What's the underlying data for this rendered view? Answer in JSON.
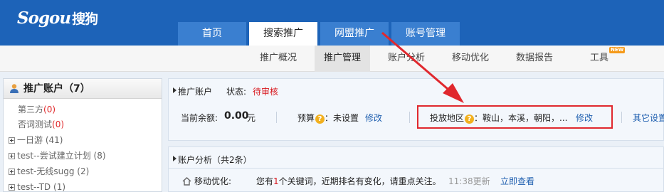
{
  "logo": {
    "text": "Sogou",
    "cn": "搜狗"
  },
  "main_tabs": [
    {
      "label": "首页"
    },
    {
      "label": "搜索推广"
    },
    {
      "label": "网盟推广"
    },
    {
      "label": "账号管理"
    }
  ],
  "sub_nav": [
    {
      "label": "推广概况"
    },
    {
      "label": "推广管理"
    },
    {
      "label": "账户分析"
    },
    {
      "label": "移动优化"
    },
    {
      "label": "数据报告"
    },
    {
      "label": "工具"
    }
  ],
  "new_badge": "NEW",
  "sidebar": {
    "title": "推广账户（7）",
    "items": [
      {
        "name": "第三方",
        "count": "(0)"
      },
      {
        "name": "否词测试",
        "count": "(0)"
      },
      {
        "name": "一日游",
        "count": "(41)"
      },
      {
        "name": "test--尝试建立计划",
        "count": "(8)"
      },
      {
        "name": "test-无线sugg",
        "count": "(2)"
      },
      {
        "name": "test--TD",
        "count": "(1)"
      }
    ]
  },
  "account": {
    "heading": "推广账户",
    "status_label": "状态:",
    "status_value": "待审核",
    "balance_label": "当前余额:",
    "balance_value": "0.00",
    "balance_unit": "元",
    "budget_label": "预算",
    "budget_value": "：未设置",
    "budget_edit": "修改",
    "region_label": "投放地区",
    "region_value": "：鞍山，本溪，朝阳，...",
    "region_edit": "修改",
    "other_settings": "其它设置"
  },
  "analysis": {
    "heading": "账户分析",
    "count": "（共2条）",
    "mobile_label": "移动优化:",
    "msg_prefix": "您有",
    "msg_count": "1",
    "msg_suffix": "个关键词，近期排名有变化，请重点关注。",
    "update_time": "11:38更新",
    "view_now": "立即查看"
  },
  "colors": {
    "header_bg": "#1d63b8",
    "tab_bg": "#3a7fd0",
    "alert_red": "#e0282e",
    "link": "#2060b0"
  }
}
